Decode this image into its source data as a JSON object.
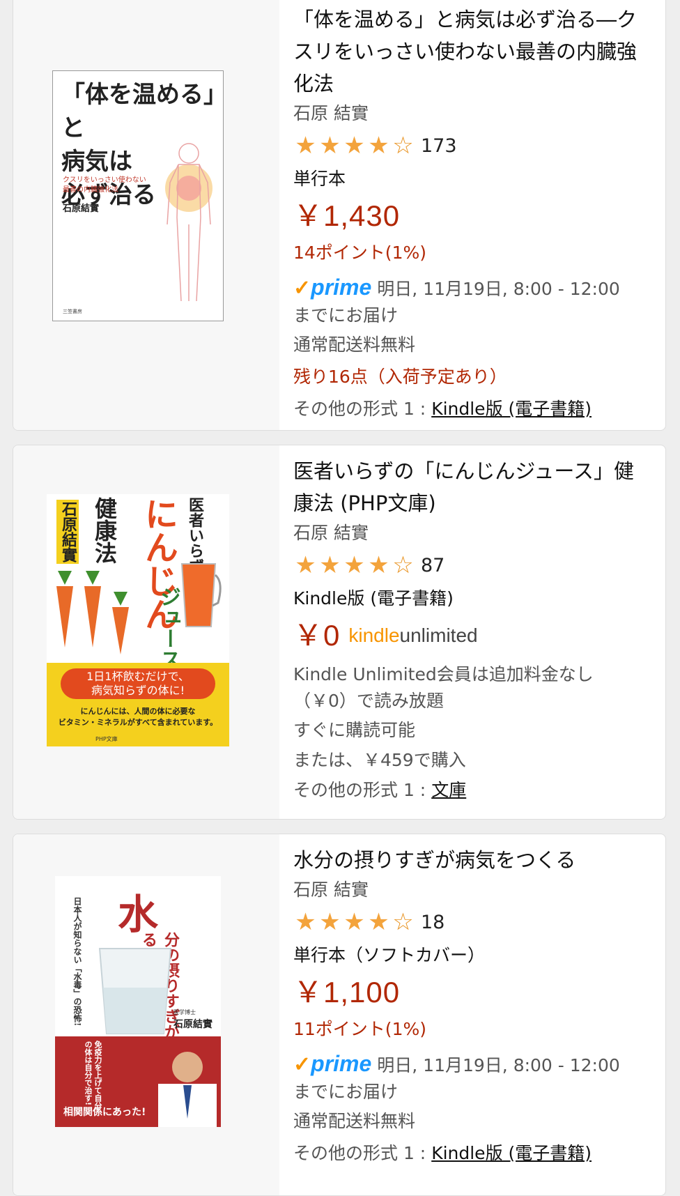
{
  "products": [
    {
      "title": "「体を温める」と病気は必ず治る―クスリをいっさい使わない最善の内臓強化法",
      "author": "石原 結實",
      "rating_count": "173",
      "stars": 3.5,
      "format": "単行本",
      "price": "￥1,430",
      "points": "14ポイント(1%)",
      "prime_label": "prime",
      "delivery": "明日, 11月19日, 8:00 - 12:00",
      "delivery_suffix": "までにお届け",
      "shipping": "通常配送料無料",
      "stock": "残り16点（入荷予定あり）",
      "other_formats_label": "その他の形式 1 :",
      "other_formats_link": "Kindle版 (電子書籍)",
      "cover": {
        "title_line1": "「体を温める」と",
        "title_line2": "病気は",
        "title_line3": "必ず治る",
        "sub1": "クスリをいっさい使わない",
        "sub2": "最善の内臓強化法",
        "author": "石原結實",
        "publisher": "三笠書房"
      }
    },
    {
      "title": "医者いらずの「にんじんジュース」健康法 (PHP文庫)",
      "author": "石原 結實",
      "rating_count": "87",
      "stars": 3.5,
      "format": "Kindle版 (電子書籍)",
      "price": "￥0",
      "ku_kindle": "kindle",
      "ku_unlimited": "unlimited",
      "ku_note1": "Kindle Unlimited会員は追加料金なし",
      "ku_note2": "（￥0）で読み放題",
      "availability": "すぐに購読可能",
      "alt_purchase": "または、￥459で購入",
      "other_formats_label": "その他の形式 1 :",
      "other_formats_link": "文庫",
      "cover": {
        "author": "石原結實",
        "series_top": "医者いらずの",
        "big": "にんじん",
        "juice": "ジュース",
        "health": "健康法",
        "pill1": "1日1杯飲むだけで、",
        "pill2": "病気知らずの体に!",
        "small1": "にんじんには、人間の体に必要な",
        "small2": "ビタミン・ミネラルがすべて含まれています。",
        "publisher": "PHP文庫"
      }
    },
    {
      "title": "水分の摂りすぎが病気をつくる",
      "author": "石原 結實",
      "rating_count": "18",
      "stars": 3.5,
      "format": "単行本（ソフトカバー）",
      "price": "￥1,100",
      "points": "11ポイント(1%)",
      "prime_label": "prime",
      "delivery": "明日, 11月19日, 8:00 - 12:00",
      "delivery_suffix": "までにお届け",
      "shipping": "通常配送料無料",
      "other_formats_label": "その他の形式 1 :",
      "other_formats_link": "Kindle版 (電子書籍)",
      "cover": {
        "big": "水",
        "rest": "分の摂りすぎが病気をつくる",
        "side": "日本人が知らない「水毒」の恐怖!",
        "author_title": "医学博士",
        "author": "石原結實",
        "band_vert": "免疫力を上げて自分の体は自分で治す!",
        "band_bottom": "相関関係にあった!"
      }
    }
  ],
  "colors": {
    "price": "#b12704",
    "star": "#f3a33c",
    "prime": "#1a98ff",
    "prime_check": "#f79400"
  }
}
